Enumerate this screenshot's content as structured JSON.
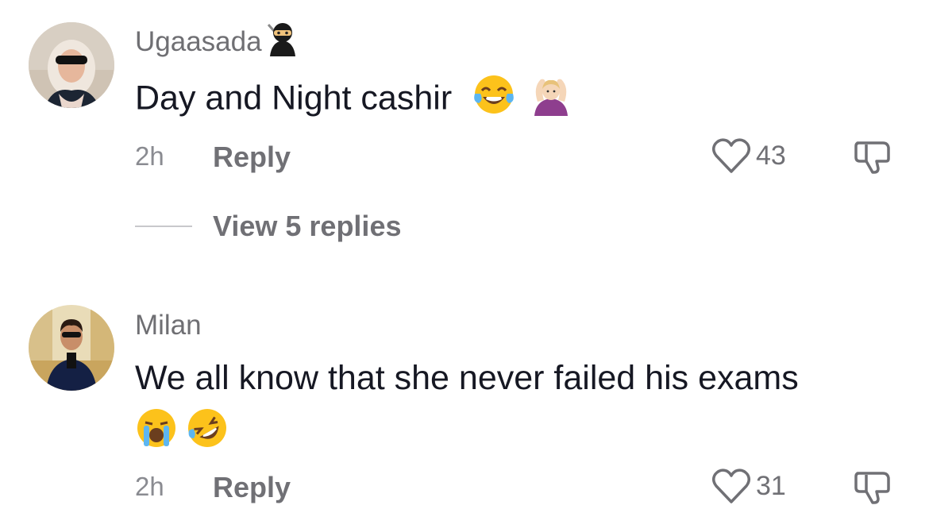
{
  "comments": [
    {
      "username": "Ugaasada",
      "username_emoji": "ninja",
      "text": "Day and Night cashir",
      "emojis": [
        "face-with-tears-of-joy",
        "person-gesturing-ok"
      ],
      "time": "2h",
      "reply_label": "Reply",
      "likes": "43",
      "view_replies": "View 5 replies"
    },
    {
      "username": "Milan",
      "text": "We all know that she never failed his exams",
      "emojis": [
        "loudly-crying-face",
        "rolling-on-floor-laughing"
      ],
      "time": "2h",
      "reply_label": "Reply",
      "likes": "31"
    }
  ]
}
